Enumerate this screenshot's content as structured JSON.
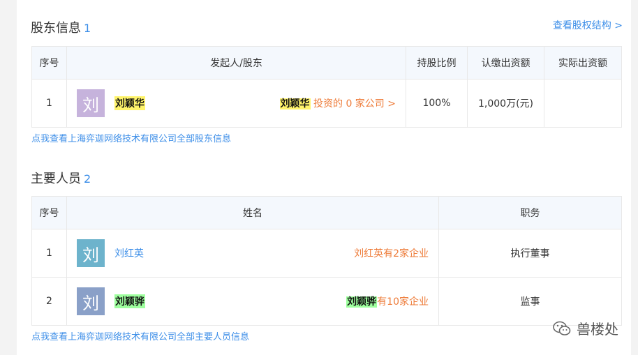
{
  "shareholders": {
    "title": "股东信息",
    "count": "1",
    "equity_link": "查看股权结构 >",
    "headers": [
      "序号",
      "发起人/股东",
      "持股比例",
      "认缴出资额",
      "实际出资额"
    ],
    "rows": [
      {
        "index": "1",
        "avatar": "刘",
        "name": "刘颖华",
        "invest_name": "刘颖华",
        "invest_text": " 投资的 0 家公司 >",
        "ratio": "100%",
        "subscribed": "1,000万(元)",
        "actual": ""
      }
    ],
    "footer_link": "点我查看上海弈迦网络技术有限公司全部股东信息"
  },
  "key_personnel": {
    "title": "主要人员",
    "count": "2",
    "headers": [
      "序号",
      "姓名",
      "职务"
    ],
    "rows": [
      {
        "index": "1",
        "avatar": "刘",
        "name": "刘红英",
        "company_name": "刘红英",
        "company_text": "有2家企业",
        "position": "执行董事"
      },
      {
        "index": "2",
        "avatar": "刘",
        "name": "刘颖骅",
        "company_name": "刘颖骅",
        "company_text": "有10家企业",
        "position": "监事"
      }
    ],
    "footer_link": "点我查看上海弈迦网络技术有限公司全部主要人员信息"
  },
  "watermark": {
    "text": "兽楼处",
    "icon": "wechat-icon"
  },
  "colors": {
    "link": "#3c8ee8",
    "orange": "#ee7c3a",
    "highlight_yellow": "#fff46b",
    "highlight_green": "#9eff9e"
  }
}
